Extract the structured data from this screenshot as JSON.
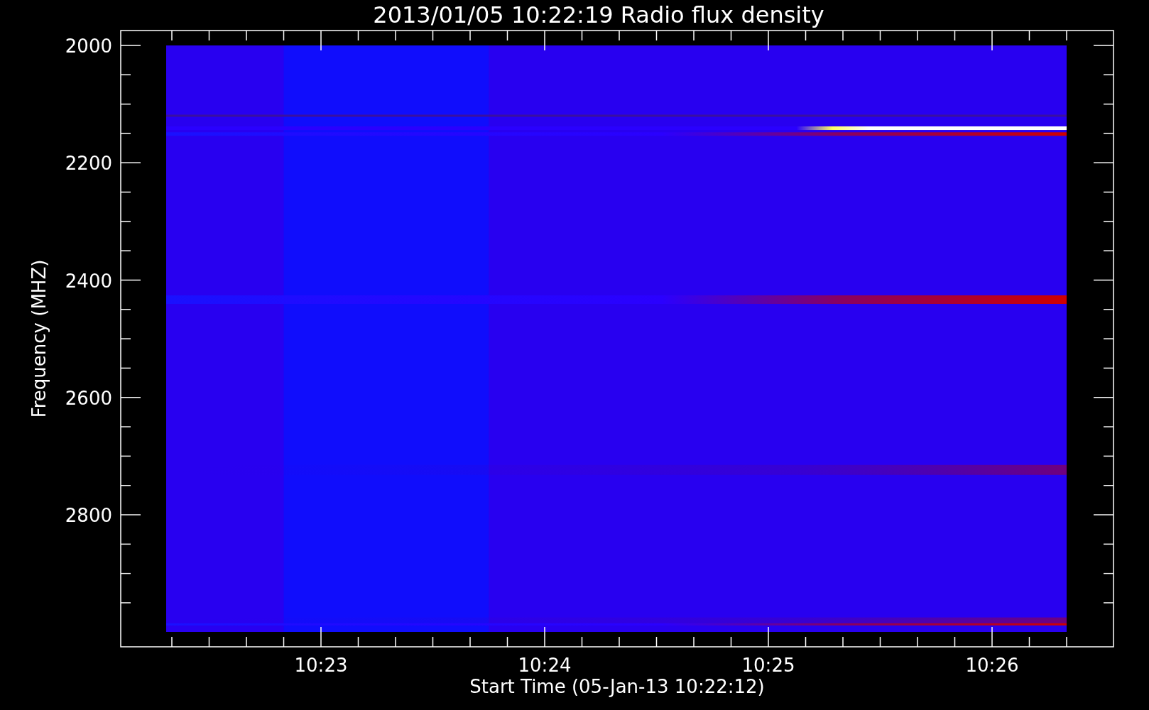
{
  "title": "2013/01/05 10:22:19 Radio flux density",
  "y_axis": {
    "label": "Frequency (MHZ)",
    "ticks": [
      "2000",
      "2200",
      "2400",
      "2600",
      "2800"
    ]
  },
  "x_axis": {
    "label": "Start Time (05-Jan-13 10:22:12)",
    "ticks": [
      "10:23",
      "10:24",
      "10:25",
      "10:26"
    ]
  }
}
